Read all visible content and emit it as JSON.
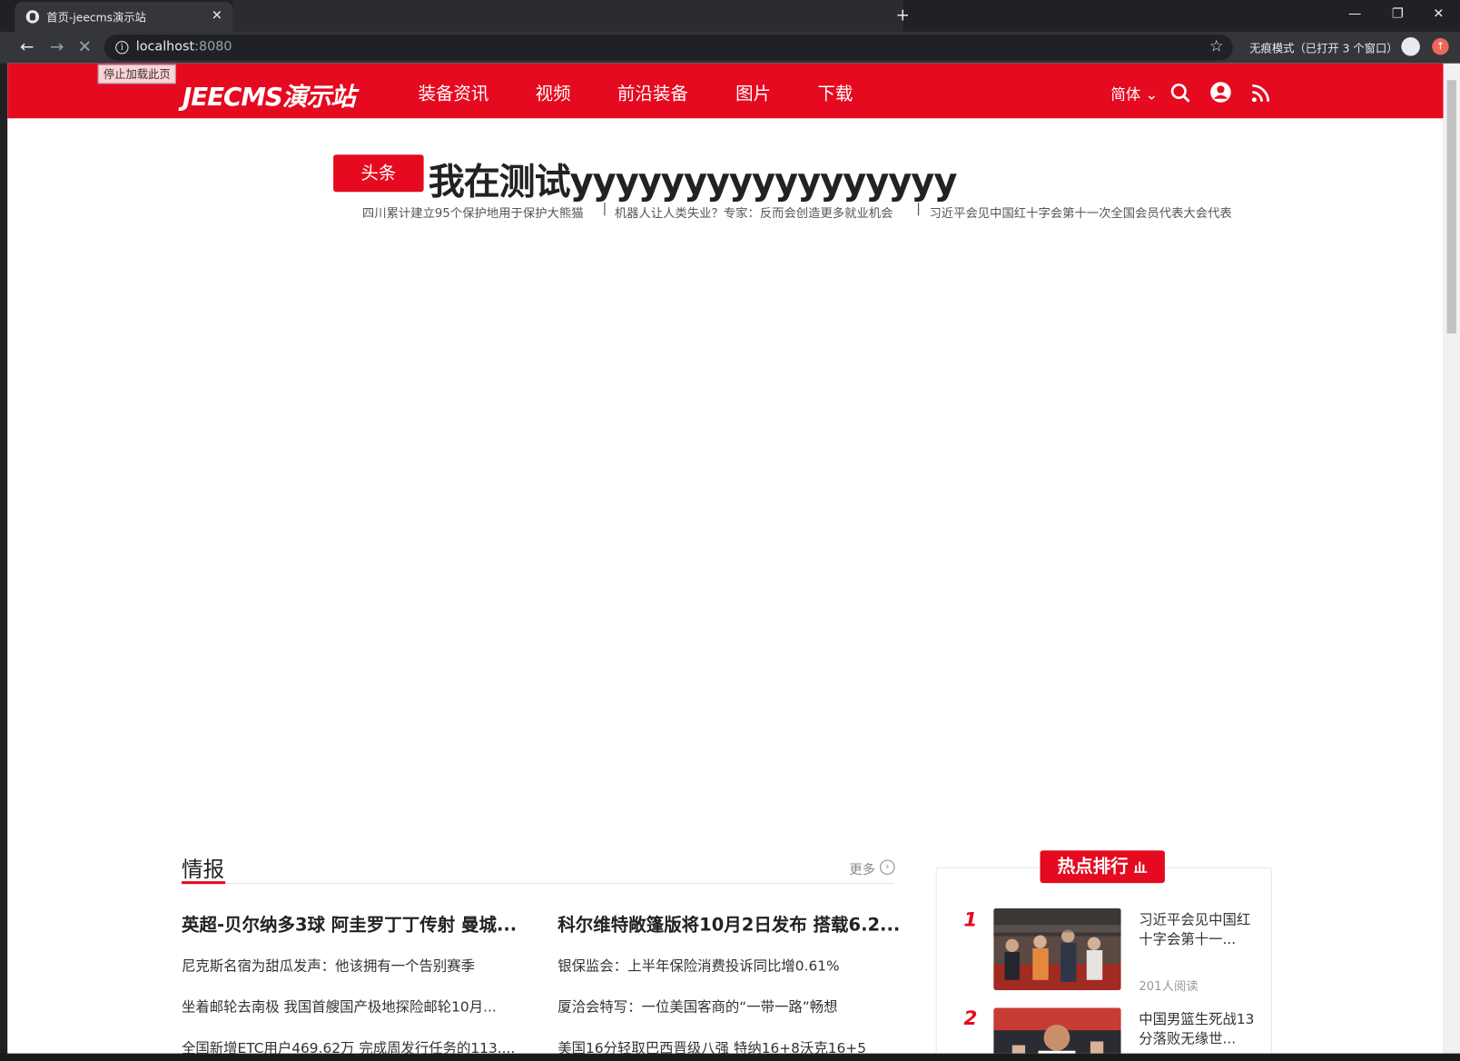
{
  "browser": {
    "tab_title": "首页-jeecms演示站",
    "url_host": "localhost",
    "url_port": ":8080",
    "incognito_label": "无痕模式（已打开 3 个窗口）",
    "tooltip": "停止加载此页"
  },
  "header": {
    "logo": "JEECMS演示站",
    "nav": [
      "装备资讯",
      "视频",
      "前沿装备",
      "图片",
      "下载"
    ],
    "lang": "简体"
  },
  "headline": {
    "badge": "头条",
    "title": "我在测试yyyyyyyyyyyyyyyyy",
    "sub_items": [
      "四川累计建立95个保护地用于保护大熊猫",
      "机器人让人类失业？专家：反而会创造更多就业机会",
      "习近平会见中国红十字会第十一次全国会员代表大会代表"
    ]
  },
  "section": {
    "title": "情报",
    "more": "更多",
    "left_big": "英超-贝尔纳多3球 阿圭罗丁丁传射 曼城...",
    "right_big": "科尔维特敞篷版将10月2日发布 搭载6.2...",
    "left_items": [
      "尼克斯名宿为甜瓜发声：他该拥有一个告别赛季",
      "坐着邮轮去南极 我国首艘国产极地探险邮轮10月...",
      "全国新增ETC用户469.62万 完成周发行任务的113...."
    ],
    "right_items": [
      "银保监会：上半年保险消费投诉同比增0.61%",
      "厦洽会特写：一位美国客商的“一带一路”畅想",
      "美国16分轻取巴西晋级八强 特纳16+8沃克16+5"
    ]
  },
  "hot": {
    "title": "热点排行",
    "items": [
      {
        "rank": "1",
        "title": "习近平会见中国红十字会第十一...",
        "meta": "201人阅读"
      },
      {
        "rank": "2",
        "title": "中国男篮生死战13分落败无缘世...",
        "meta": ""
      }
    ]
  },
  "colors": {
    "brand": "#e50a1f"
  }
}
